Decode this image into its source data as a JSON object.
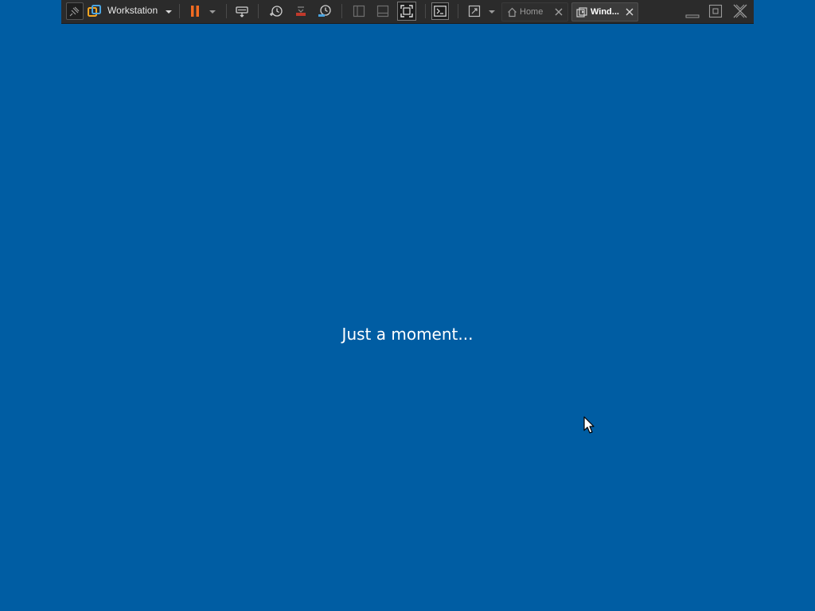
{
  "toolbar": {
    "product_label": "Workstation",
    "icons": {
      "pin": "pin-icon",
      "product": "vmware-workstation-icon",
      "product_menu": "chevron-down-icon",
      "pause": "pause-icon",
      "power_menu": "chevron-down-icon",
      "send_keys": "send-ctrl-alt-del-icon",
      "snapshot_take": "snapshot-icon",
      "snapshot_revert": "snapshot-revert-icon",
      "snapshot_manager": "snapshot-manager-icon",
      "show_library": "library-panel-icon",
      "show_thumbnails": "thumbnail-bar-icon",
      "fullscreen": "fullscreen-icon",
      "console": "console-icon",
      "stretch": "stretch-icon",
      "stretch_menu": "chevron-down-icon",
      "minimize": "minimize-icon",
      "restore": "restore-icon",
      "close": "close-icon"
    },
    "accent_color": "#f26b21",
    "tabs": [
      {
        "label": "Home",
        "icon": "home-icon",
        "active": false
      },
      {
        "label": "Wind...",
        "icon": "vm-icon",
        "active": true
      }
    ]
  },
  "guest": {
    "background_color": "#005da3",
    "message": "Just a moment..."
  }
}
